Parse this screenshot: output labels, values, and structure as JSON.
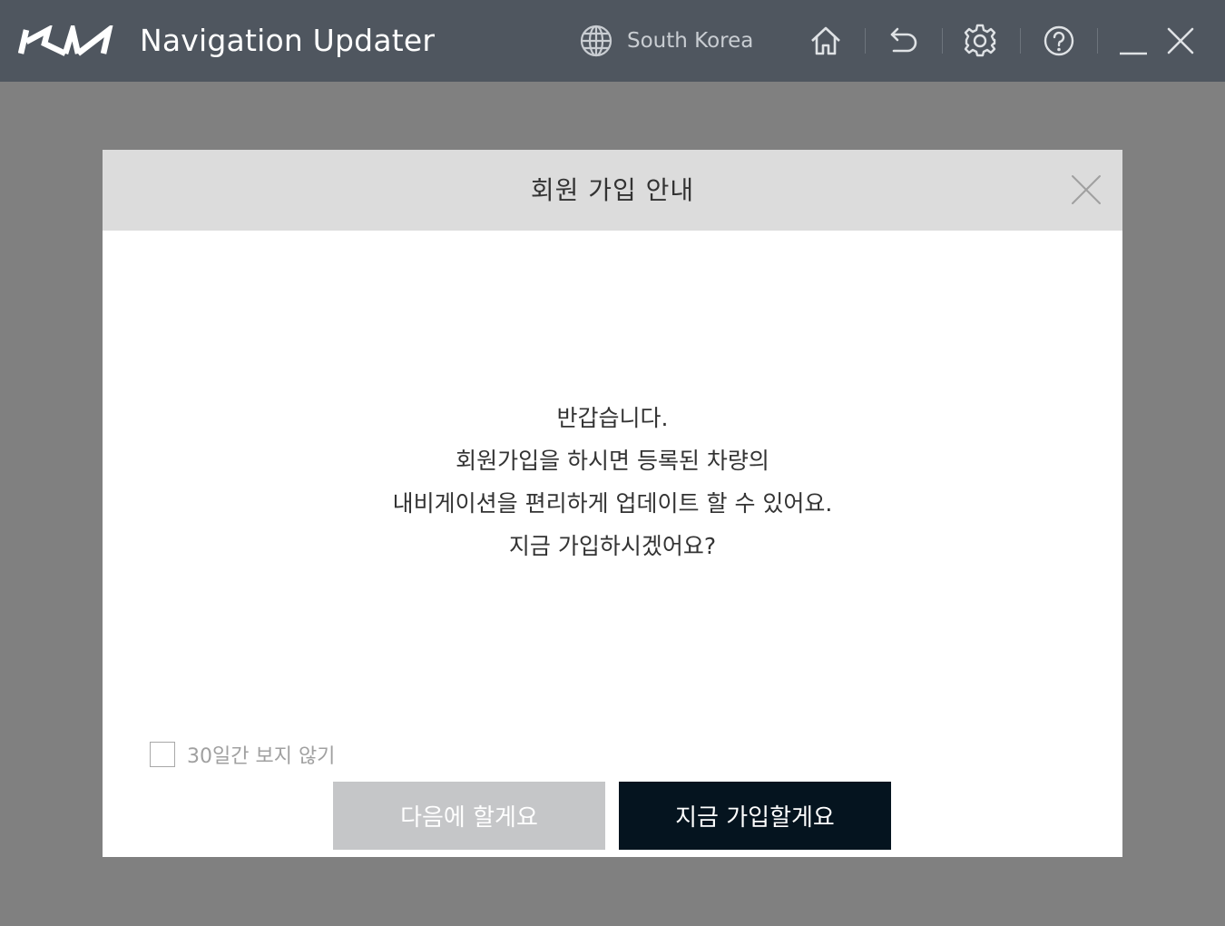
{
  "titlebar": {
    "brand": "KIA",
    "app_title": "Navigation Updater",
    "region_label": "South Korea",
    "icons": [
      "globe-icon",
      "home-icon",
      "undo-icon",
      "gear-icon",
      "help-icon",
      "minimize-icon",
      "close-icon"
    ]
  },
  "dialog": {
    "title": "회원 가입 안내",
    "message_lines": [
      "반갑습니다.",
      "회원가입을 하시면 등록된 차량의",
      "내비게이션을 편리하게 업데이트 할 수 있어요.",
      "지금 가입하시겠어요?"
    ],
    "dont_show_label": "30일간 보지 않기",
    "dont_show_checked": false,
    "later_button": "다음에 할게요",
    "join_button": "지금 가입할게요"
  },
  "colors": {
    "titlebar_bg": "#4f565f",
    "overlay_bg": "#808080",
    "join_button_bg": "#05141f",
    "later_button_bg": "#c5c6c8"
  }
}
